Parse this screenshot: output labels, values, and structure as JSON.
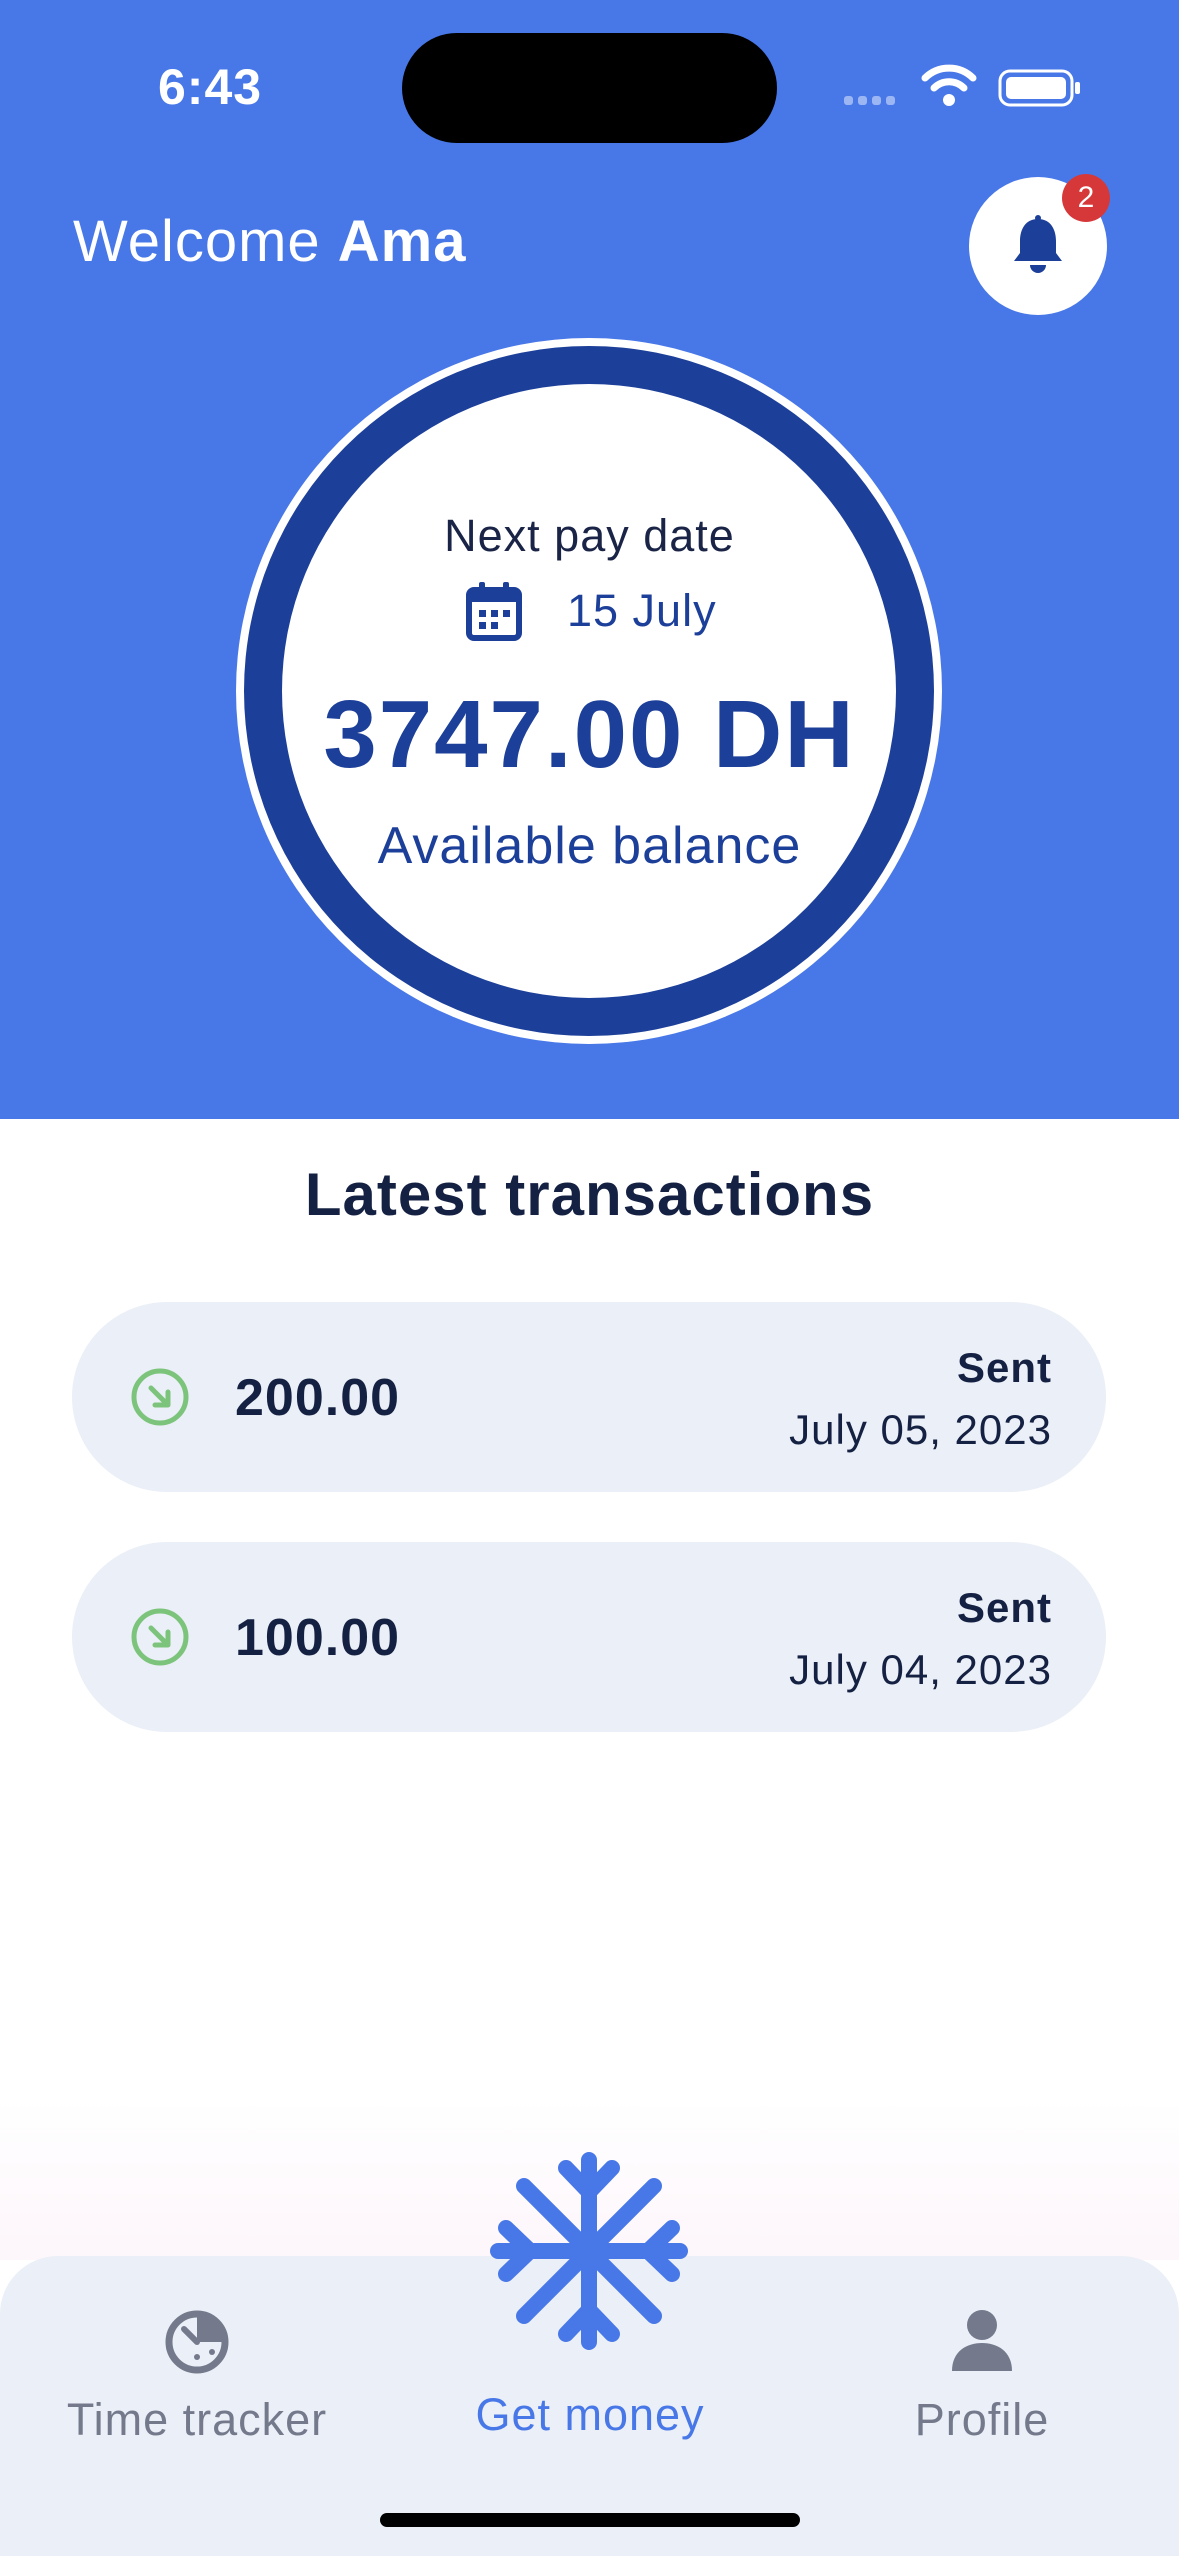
{
  "status_bar": {
    "time": "6:43"
  },
  "header": {
    "welcome_prefix": "Welcome",
    "user_name": "Ama",
    "notification_count": "2"
  },
  "balance": {
    "next_pay_label": "Next pay date",
    "next_pay_date": "15 July",
    "amount": "3747.00 DH",
    "caption": "Available balance"
  },
  "transactions": {
    "title": "Latest transactions",
    "items": [
      {
        "amount": "200.00",
        "status": "Sent",
        "date": "July 05, 2023"
      },
      {
        "amount": "100.00",
        "status": "Sent",
        "date": "July 04, 2023"
      }
    ]
  },
  "tabbar": {
    "tabs": [
      {
        "label": "Time tracker",
        "icon": "timer-icon"
      },
      {
        "label": "Get money",
        "icon": "snowflake-icon",
        "active": true
      },
      {
        "label": "Profile",
        "icon": "person-icon"
      }
    ]
  },
  "colors": {
    "hero_blue": "#4878e8",
    "navy": "#1c3f99",
    "badge_red": "#d6383a",
    "incoming_green": "#7cc47c",
    "card_bg": "#ebeff7"
  }
}
